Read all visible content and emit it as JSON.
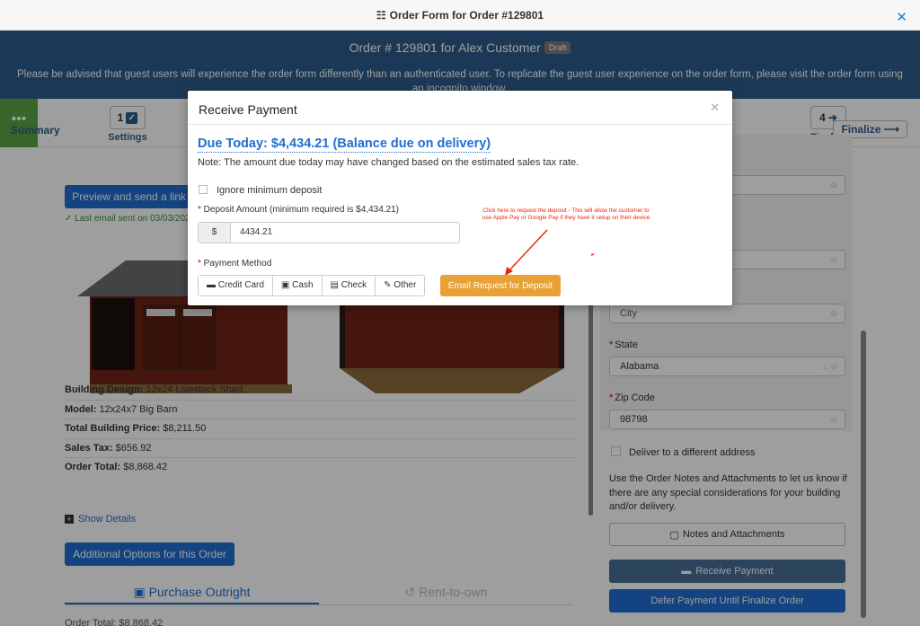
{
  "window": {
    "title": "Order Form for Order #129801"
  },
  "banner": {
    "title": "Order # 129801 for Alex Customer",
    "badge": "Draft",
    "note": "Please be advised that guest users will experience the order form differently than an authenticated user. To replicate the guest user experience on the order form, please visit the order form using an incognito window."
  },
  "steps": [
    {
      "number": "1",
      "label": "Settings"
    },
    {
      "number": "4",
      "label": "Finalize"
    }
  ],
  "summary_label": "Summary",
  "finalize_button": "Finalize",
  "left": {
    "preview_button": "Preview and send a link t",
    "last_email": "Last email sent on 03/03/202",
    "specs": [
      {
        "label": "Building Design:",
        "value": "12x24 Livestock Shed"
      },
      {
        "label": "Model:",
        "value": "12x24x7 Big Barn"
      },
      {
        "label": "Total Building Price:",
        "value": "$8,211.50"
      },
      {
        "label": "Sales Tax:",
        "value": "$656.92"
      },
      {
        "label": "Order Total:",
        "value": "$8,868.42"
      }
    ],
    "show_details": "Show Details",
    "additional_options": "Additional Options for this Order",
    "tabs": [
      "Purchase Outright",
      "Rent-to-own"
    ],
    "order_total_bottom": "Order Total: $8,868.42"
  },
  "right": {
    "city_placeholder": "City",
    "state_label": "State",
    "state_value": "Alabama",
    "zip_label": "Zip Code",
    "zip_value": "98798",
    "deliver_different": "Deliver to a different address",
    "notes_text": "Use the Order Notes and Attachments to let us know if there are any special considerations for your building and/or delivery.",
    "notes_button": "Notes and Attachments",
    "receive_payment_button": "Receive Payment",
    "defer_button": "Defer Payment Until Finalize Order"
  },
  "modal": {
    "title": "Receive Payment",
    "due_today": "Due Today: $4,434.21 (Balance due on delivery)",
    "note": "Note: The amount due today may have changed based on the estimated sales tax rate.",
    "ignore_min": "Ignore minimum deposit",
    "deposit_label": "Deposit Amount (minimum required is $4,434.21)",
    "currency": "$",
    "deposit_value": "4434.21",
    "payment_method_label": "Payment Method",
    "methods": [
      "Credit Card",
      "Cash",
      "Check",
      "Other"
    ],
    "email_request": "Email Request for Deposit"
  },
  "annotation": "Click here to request the deposit - This will allow the customer to use Apple Pay or Google Pay if they have it setup on their device",
  "colors": {
    "brand": "#2d5c8c",
    "primary": "#1f6fd0",
    "accent": "#e9a035",
    "annotation": "#e6280f"
  }
}
